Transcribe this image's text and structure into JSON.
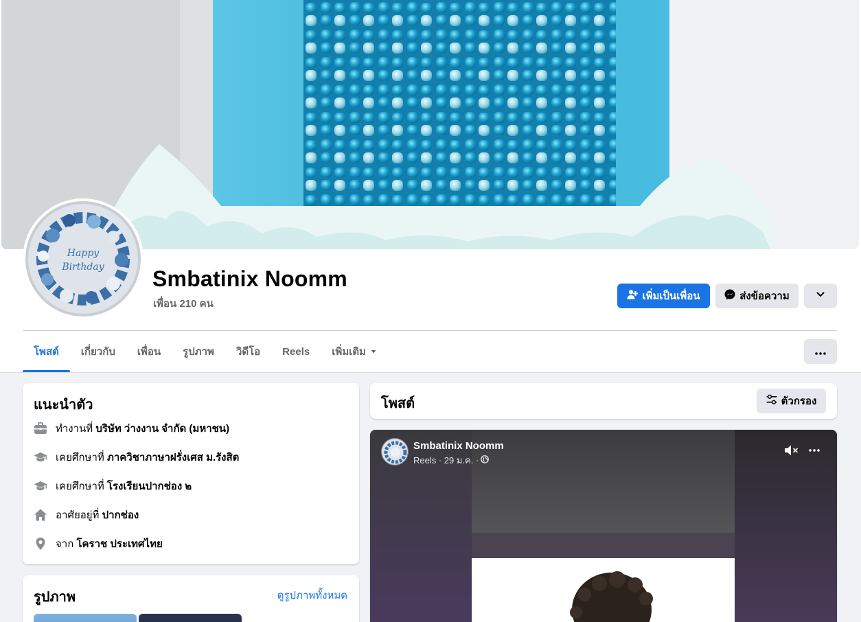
{
  "profile": {
    "name": "Smbatinix Noomm",
    "friends": "เพื่อน 210 คน"
  },
  "actions": {
    "add_friend": "เพิ่มเป็นเพื่อน",
    "message": "ส่งข้อความ"
  },
  "tabs": [
    {
      "label": "โพสต์",
      "active": true
    },
    {
      "label": "เกี่ยวกับ"
    },
    {
      "label": "เพื่อน"
    },
    {
      "label": "รูปภาพ"
    },
    {
      "label": "วิดีโอ"
    },
    {
      "label": "Reels"
    },
    {
      "label": "เพิ่มเติม"
    }
  ],
  "intro": {
    "title": "แนะนำตัว",
    "items": [
      {
        "icon": "briefcase-icon",
        "prefix": "ทำงานที่",
        "value": "บริษัท ว่างงาน จำกัด (มหาชน)"
      },
      {
        "icon": "graduation-cap-icon",
        "prefix": "เคยศึกษาที่",
        "value": "ภาควิชาภาษาฝรั่งเศส ม.รังสิต"
      },
      {
        "icon": "graduation-cap-icon",
        "prefix": "เคยศึกษาที่",
        "value": "โรงเรียนปากช่อง ๒"
      },
      {
        "icon": "home-icon",
        "prefix": "อาศัยอยู่ที่",
        "value": "ปากช่อง"
      },
      {
        "icon": "location-pin-icon",
        "prefix": "จาก",
        "value": "โคราช ประเทศไทย"
      }
    ]
  },
  "photos": {
    "title": "รูปภาพ",
    "see_all": "ดูรูปภาพทั้งหมด"
  },
  "posts": {
    "title": "โพสต์",
    "filter": "ตัวกรอง"
  },
  "post": {
    "author": "Smbatinix Noomm",
    "meta": "Reels · 29 ม.ค. ·"
  },
  "colors": {
    "accent": "#1b74e4",
    "background": "#f0f2f5",
    "secondary_button": "#e4e6eb"
  }
}
